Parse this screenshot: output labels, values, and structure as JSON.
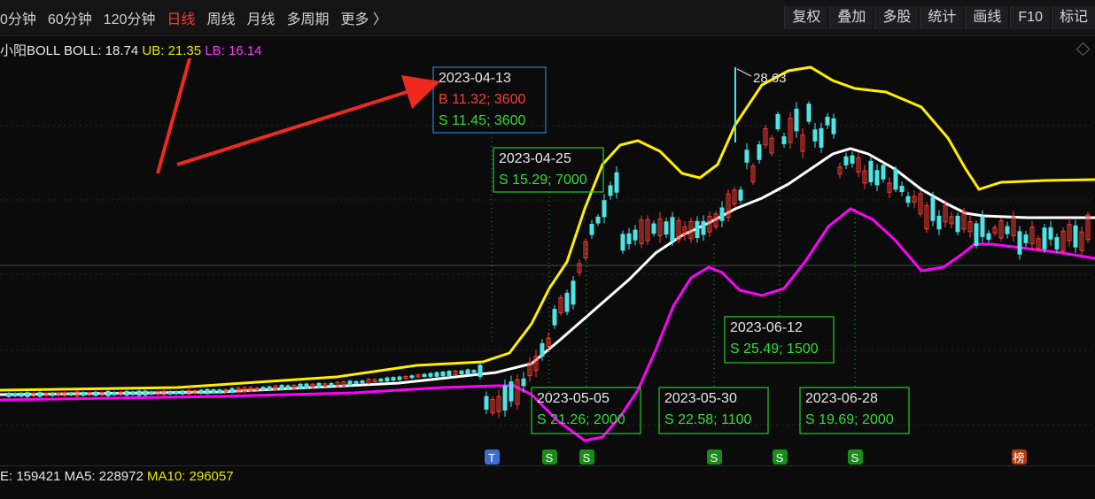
{
  "toolbar": {
    "periods": [
      "0分钟",
      "60分钟",
      "120分钟",
      "日线",
      "周线",
      "月线",
      "多周期",
      "更多 〉"
    ],
    "active": "日线",
    "tools": [
      "复权",
      "叠加",
      "多股",
      "统计",
      "画线",
      "F10",
      "标记"
    ]
  },
  "indicator": {
    "name_prefix": "小阳BOLL",
    "boll_label": "BOLL: 18.74",
    "ub_label": "UB: 21.35",
    "lb_label": "LB: 16.14"
  },
  "volume_bar": {
    "vol_label": "E: 159421",
    "ma5_label": "MA5: 228972",
    "ma10_label": "MA10: 296057"
  },
  "colors": {
    "up": "#ff3b30",
    "down": "#4fe3e3",
    "boll_mid": "#ffffff",
    "boll_upper": "#ffee00",
    "boll_lower": "#ff00ff",
    "annotation_green": "#22cc22",
    "annotation_blue": "#2b7fc4",
    "arrow": "#ee2a1e"
  },
  "chart_data": {
    "type": "candlestick",
    "peak_label": "28.63",
    "annotations": [
      {
        "date": "2023-04-13",
        "lines": [
          "B 11.32; 3600",
          "S 11.45; 3600"
        ],
        "style": "blue"
      },
      {
        "date": "2023-04-25",
        "lines": [
          "S 15.29; 7000"
        ],
        "style": "green"
      },
      {
        "date": "2023-05-05",
        "lines": [
          "S 21.26; 2000"
        ],
        "style": "green"
      },
      {
        "date": "2023-05-30",
        "lines": [
          "S 22.58; 1100"
        ],
        "style": "green"
      },
      {
        "date": "2023-06-12",
        "lines": [
          "S 25.49; 1500"
        ],
        "style": "green"
      },
      {
        "date": "2023-06-28",
        "lines": [
          "S 19.69; 2000"
        ],
        "style": "green"
      }
    ],
    "markers": [
      {
        "label": "T",
        "kind": "trade-blue"
      },
      {
        "label": "S",
        "kind": "sell"
      },
      {
        "label": "S",
        "kind": "sell"
      },
      {
        "label": "S",
        "kind": "sell"
      },
      {
        "label": "S",
        "kind": "sell"
      },
      {
        "label": "S",
        "kind": "sell"
      },
      {
        "label": "榜",
        "kind": "rank"
      }
    ]
  }
}
